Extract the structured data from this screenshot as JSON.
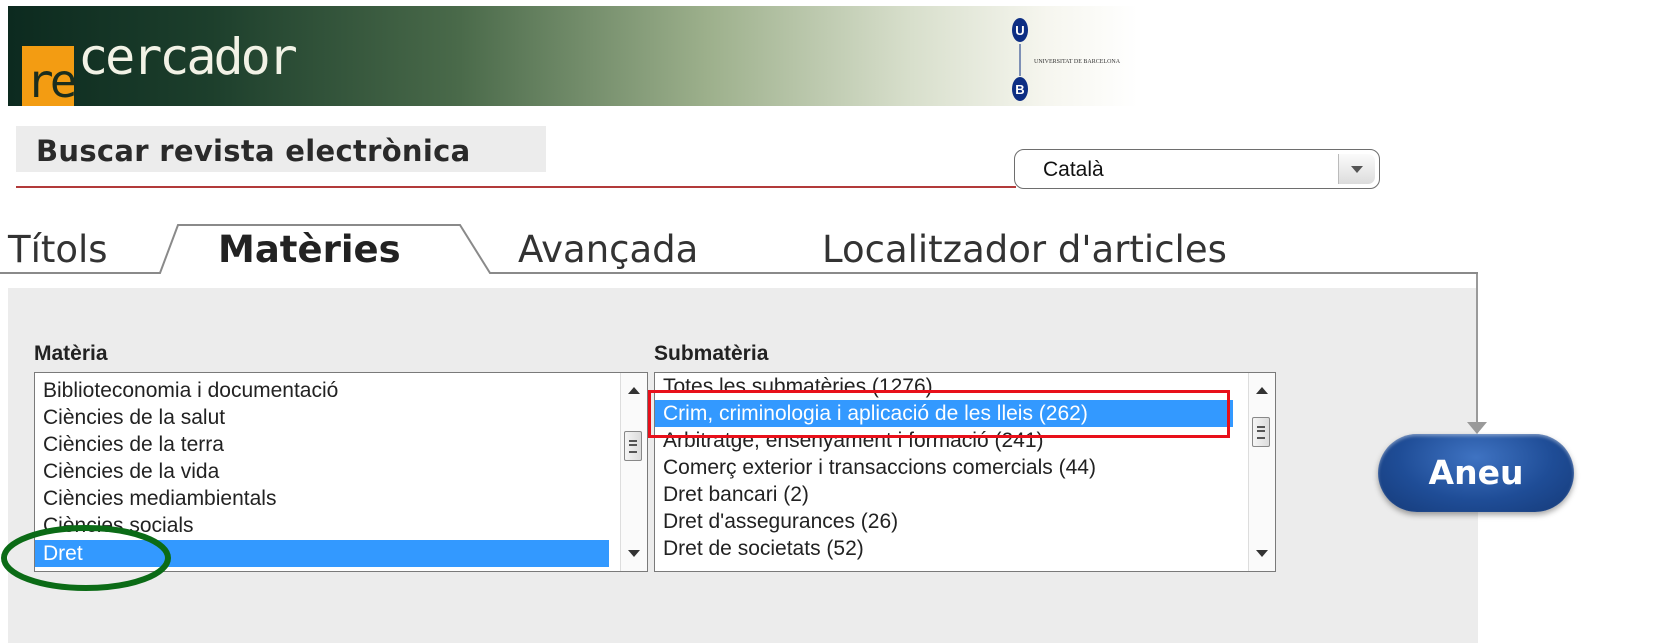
{
  "brand": {
    "logo_prefix": "re",
    "logo_suffix": "cercador",
    "university_mark_letters": [
      "U",
      "B"
    ],
    "university_name": "UNIVERSITAT DE BARCELONA"
  },
  "search": {
    "title": "Buscar revista electrònica",
    "language": {
      "selected": "Català"
    }
  },
  "tabs": [
    {
      "label": "Títols",
      "active": false
    },
    {
      "label": "Matèries",
      "active": true
    },
    {
      "label": "Avançada",
      "active": false
    },
    {
      "label": "Localitzador d'articles",
      "active": false
    }
  ],
  "materia": {
    "label": "Matèria",
    "items": [
      "Biblioteconomia i documentació",
      "Ciències de la salut",
      "Ciències de la terra",
      "Ciències de la vida",
      "Ciències mediambientals",
      "Ciències socials",
      "Dret"
    ],
    "selected_index": 6
  },
  "submateria": {
    "label": "Submatèria",
    "items": [
      "Totes les submatèries (1276)",
      "Crim, criminologia i aplicació de les lleis (262)",
      "Arbitratge, ensenyament i formació (241)",
      "Comerç exterior i transaccions comercials (44)",
      "Dret bancari (2)",
      "Dret d'assegurances (26)",
      "Dret de societats (52)"
    ],
    "selected_index": 1
  },
  "go_button": {
    "label": "Aneu"
  },
  "colors": {
    "selection": "#3399ff",
    "annotation_red": "#e8101a",
    "annotation_green": "#0b6b16",
    "button_blue": "#1f4d97",
    "logo_orange": "#f39c12"
  }
}
